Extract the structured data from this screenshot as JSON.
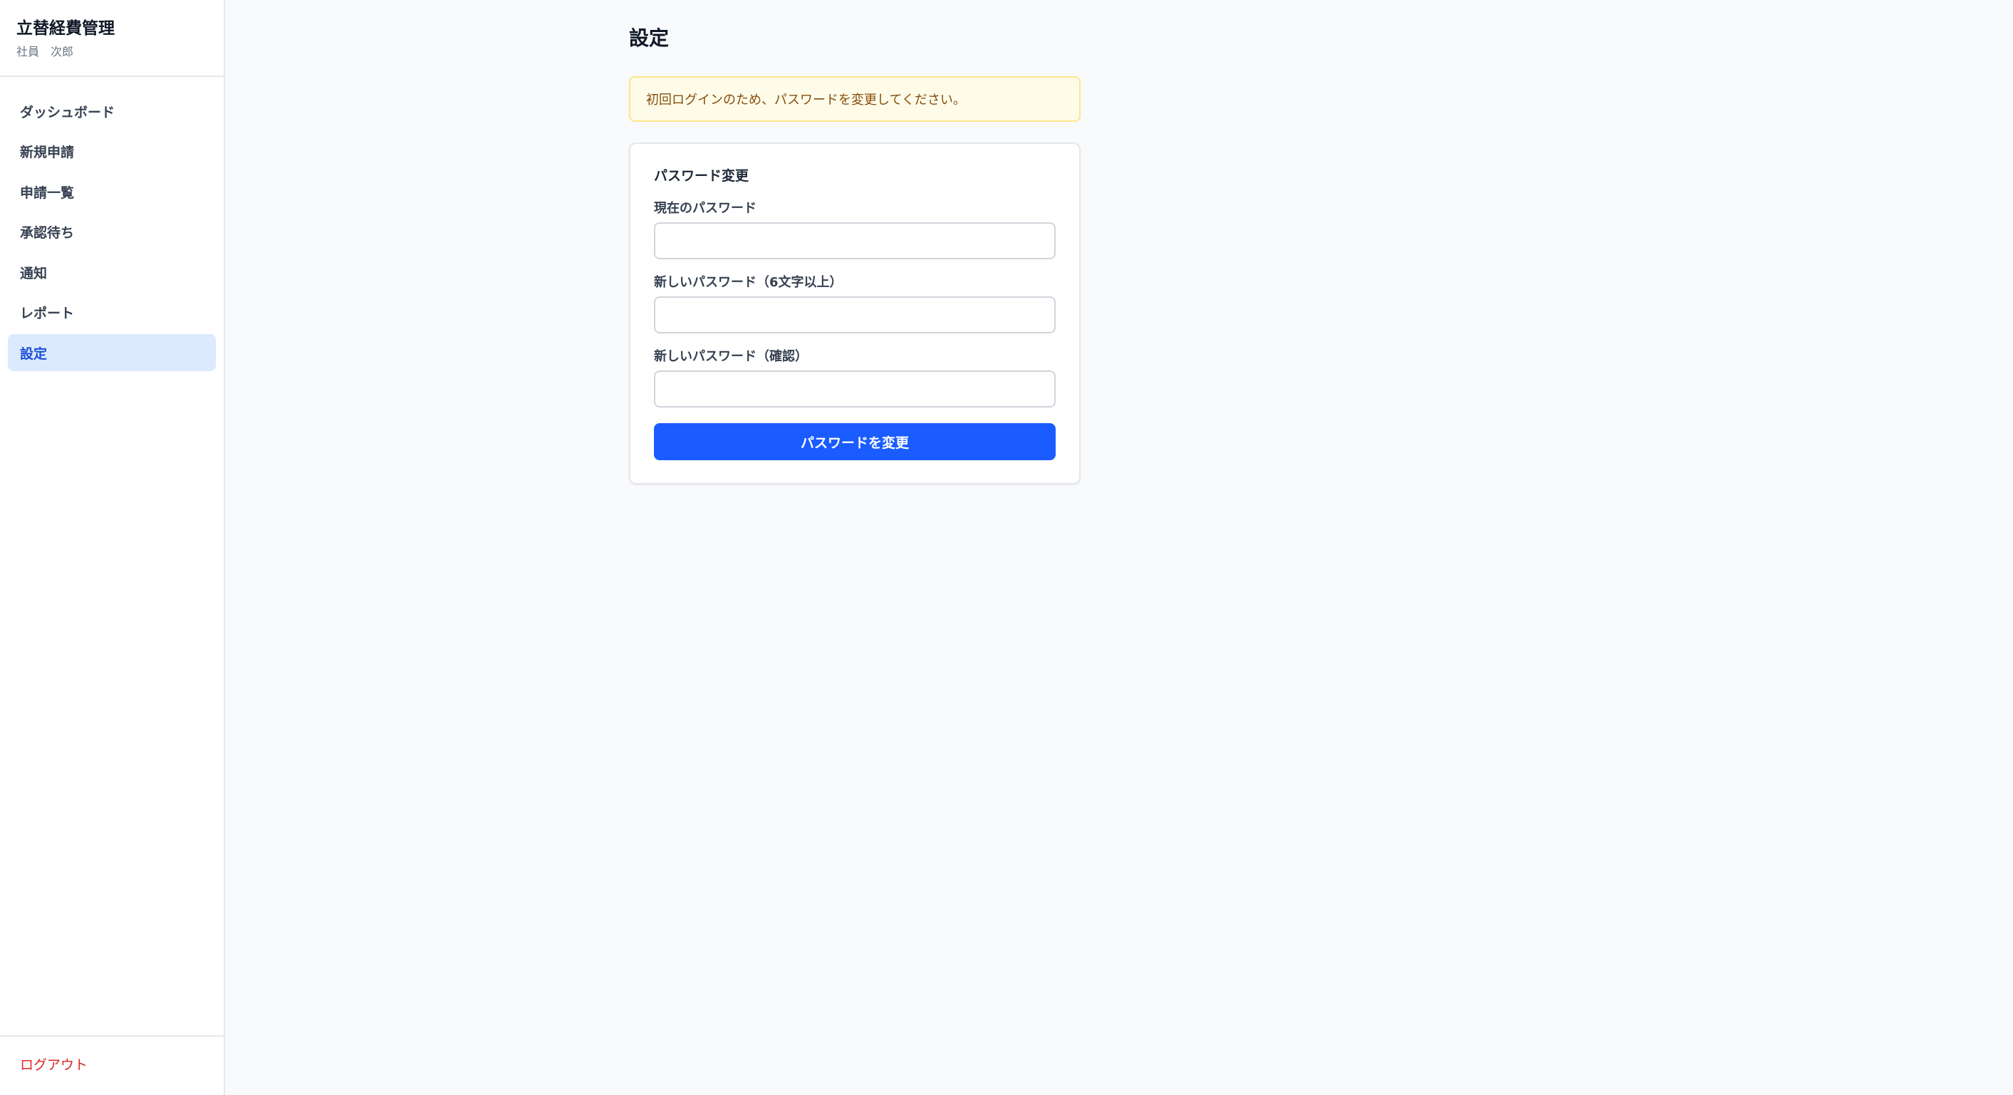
{
  "app": {
    "title": "立替経費管理",
    "user": "社員　次郎"
  },
  "sidebar": {
    "items": [
      {
        "label": "ダッシュボード",
        "active": false
      },
      {
        "label": "新規申請",
        "active": false
      },
      {
        "label": "申請一覧",
        "active": false
      },
      {
        "label": "承認待ち",
        "active": false
      },
      {
        "label": "通知",
        "active": false
      },
      {
        "label": "レポート",
        "active": false
      },
      {
        "label": "設定",
        "active": true
      }
    ],
    "logout_label": "ログアウト"
  },
  "main": {
    "page_title": "設定",
    "notice": "初回ログインのため、パスワードを変更してください。",
    "card": {
      "title": "パスワード変更",
      "fields": [
        {
          "label": "現在のパスワード",
          "value": ""
        },
        {
          "label": "新しいパスワード（6文字以上）",
          "value": ""
        },
        {
          "label": "新しいパスワード（確認）",
          "value": ""
        }
      ],
      "submit_label": "パスワードを変更"
    }
  },
  "colors": {
    "accent": "#1a5cff",
    "active_bg": "#dbeafe",
    "active_text": "#1d4ed8",
    "notice_bg": "#fefce8",
    "notice_border": "#fde68a",
    "logout": "#dc2626"
  }
}
